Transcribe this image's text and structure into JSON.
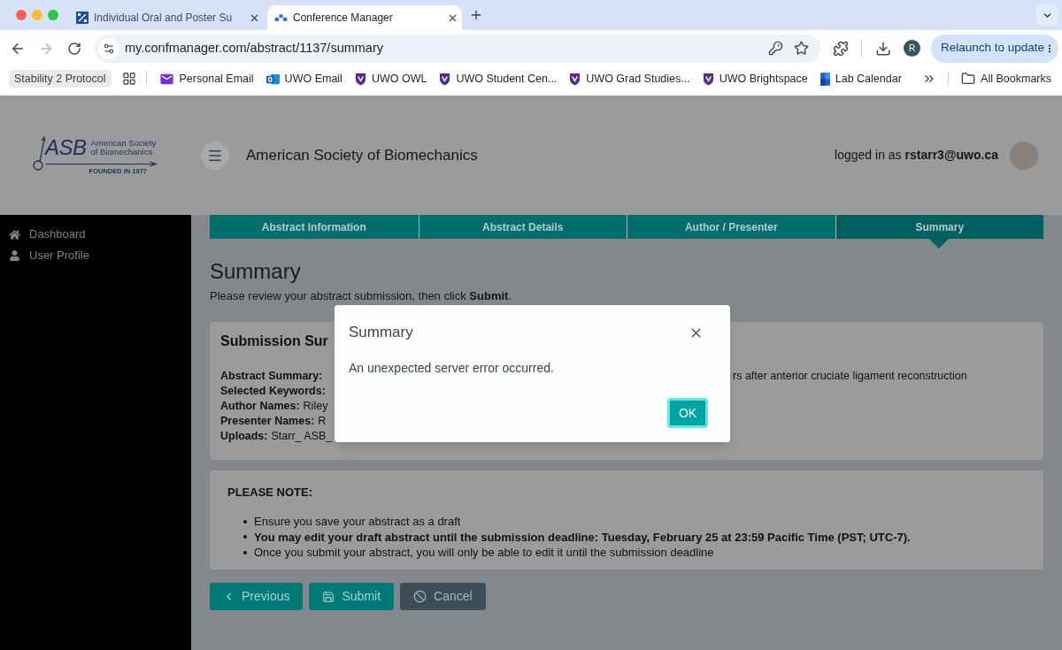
{
  "browser": {
    "tabs": [
      {
        "title": "Individual Oral and Poster Su",
        "selected": false
      },
      {
        "title": "Conference Manager",
        "selected": true
      }
    ],
    "address": "my.confmanager.com/abstract/1137/summary",
    "profile_initial": "R",
    "update_button": "Relaunch to update",
    "bookmarks": [
      {
        "label": "Stability 2 Protocol",
        "kind": "chip"
      },
      {
        "label": "Personal Email",
        "kind": "link"
      },
      {
        "label": "UWO Email",
        "kind": "link"
      },
      {
        "label": "UWO OWL",
        "kind": "link"
      },
      {
        "label": "UWO Student Cen...",
        "kind": "link"
      },
      {
        "label": "UWO Grad Studies...",
        "kind": "link"
      },
      {
        "label": "UWO Brightspace",
        "kind": "link"
      },
      {
        "label": "Lab Calendar",
        "kind": "link"
      }
    ],
    "all_bookmarks": "All Bookmarks"
  },
  "site": {
    "logo": {
      "mark": "ASB",
      "name": [
        "American Society",
        "of Biomechanics"
      ],
      "tagline": "FOUNDED IN 1977"
    },
    "title": "American Society of Biomechanics",
    "user": {
      "prefix": "logged in as",
      "email": "rstarr3@uwo.ca"
    }
  },
  "sidebar": {
    "items": [
      {
        "label": "Dashboard"
      },
      {
        "label": "User Profile"
      }
    ]
  },
  "steps": [
    {
      "label": "Abstract Information",
      "selected": false
    },
    {
      "label": "Abstract Details",
      "selected": false
    },
    {
      "label": "Author / Presenter",
      "selected": false
    },
    {
      "label": "Summary",
      "selected": true
    }
  ],
  "page": {
    "heading": "Summary",
    "intro": "Please review your abstract submission, then click **Submit**."
  },
  "submission_card": {
    "title": "Submission Sur",
    "rows": [
      {
        "label": "Abstract Summary:",
        "tail": "rs after anterior cruciate ligament reconstruction"
      },
      {
        "label": "Selected Keywords:"
      },
      {
        "label": "Author Names:",
        "value": "Riley"
      },
      {
        "label": "Presenter Names:",
        "value": "R"
      },
      {
        "label": "Uploads:",
        "value": "Starr_ ASB_"
      }
    ]
  },
  "note_card": {
    "title": "PLEASE NOTE:",
    "items": [
      {
        "text": "Ensure you save your abstract as a draft",
        "bold": false
      },
      {
        "text": "You may edit your draft abstract until the submission deadline: Tuesday, February 25 at 23:59 Pacific Time (PST; UTC-7).",
        "bold": true
      },
      {
        "text": "Once you submit your abstract, you will only be able to edit it until the submission deadline",
        "bold": false
      }
    ]
  },
  "actions": [
    {
      "label": "Previous",
      "kind": "back"
    },
    {
      "label": "Submit",
      "kind": "save"
    },
    {
      "label": "Cancel",
      "kind": "cancel"
    }
  ],
  "dialog": {
    "title": "Summary",
    "message": "An unexpected server error occurred.",
    "button": "OK"
  }
}
